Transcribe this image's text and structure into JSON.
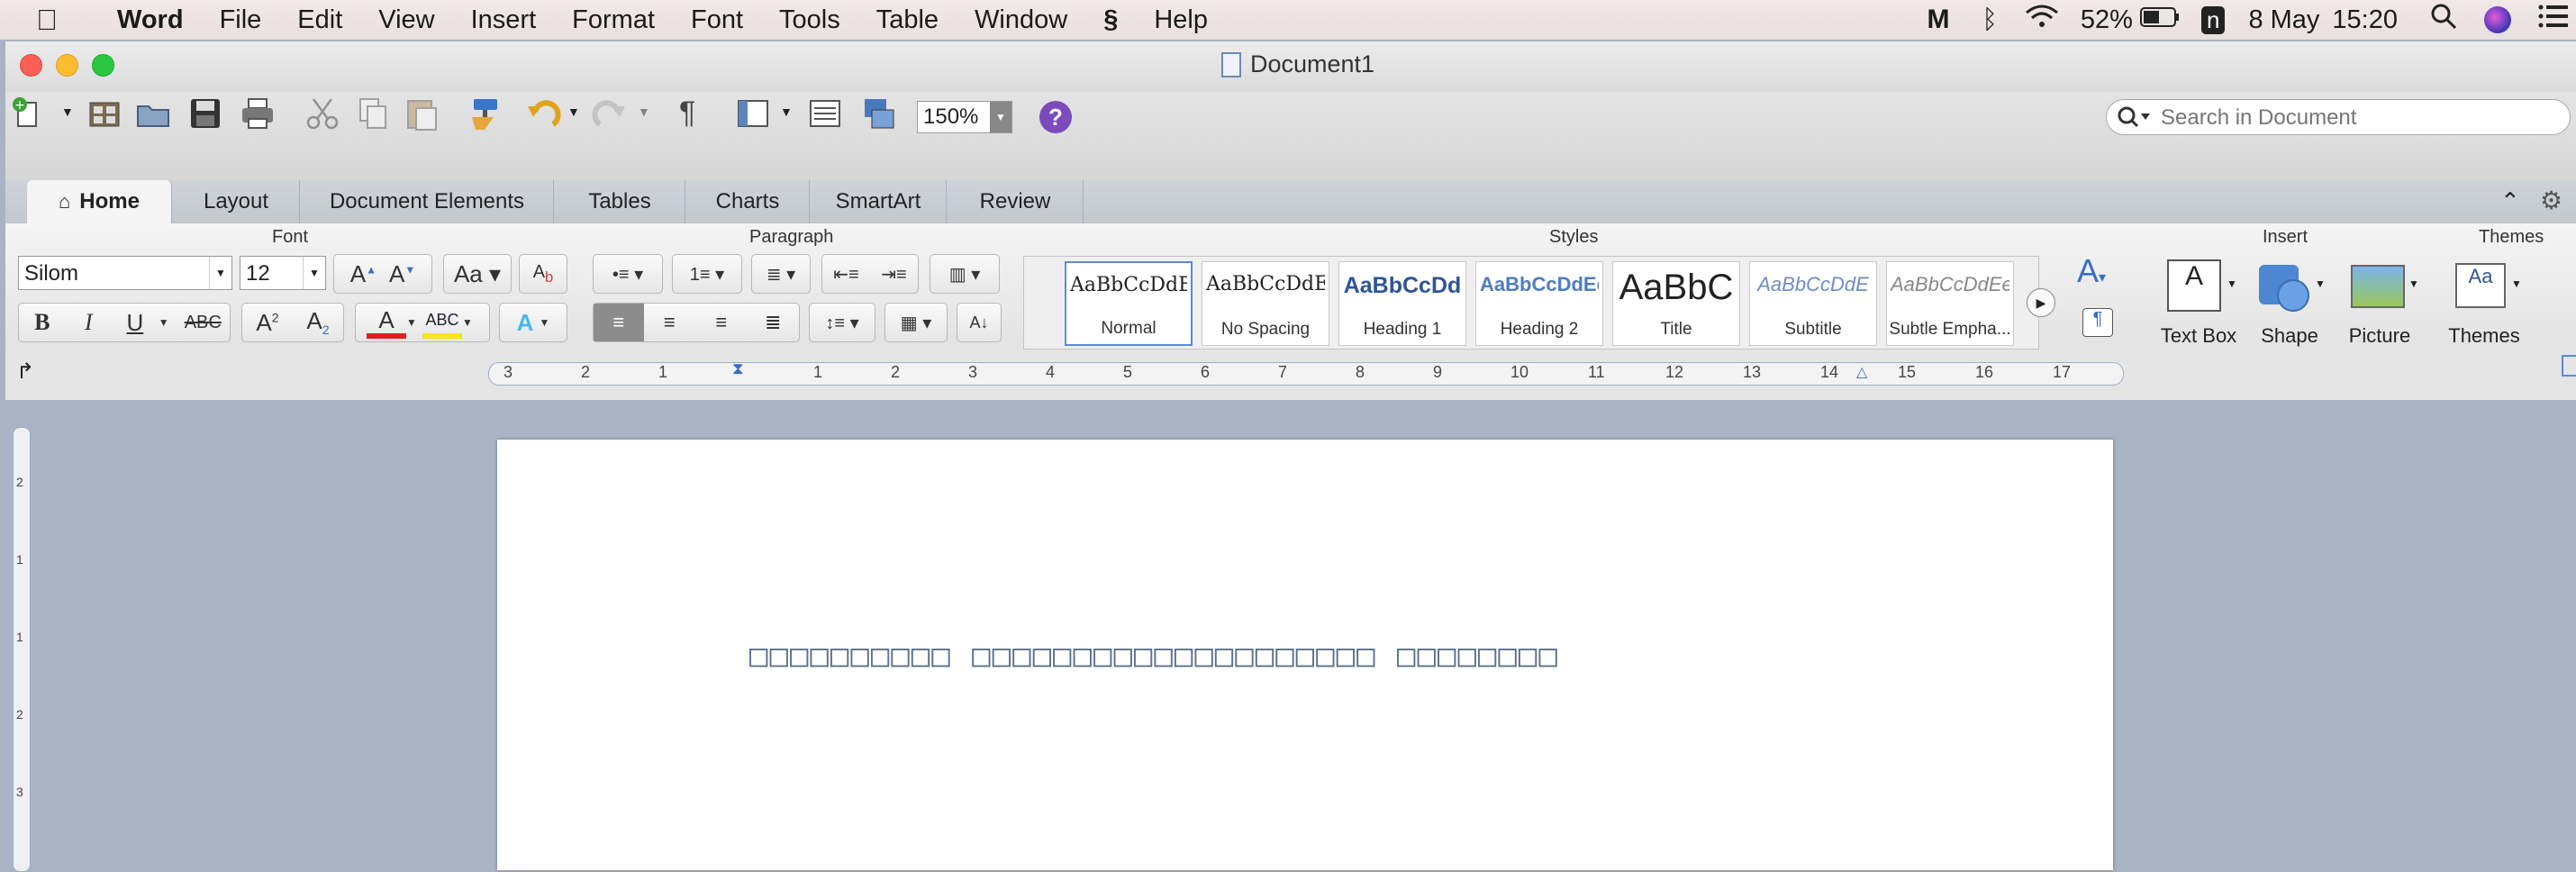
{
  "menubar": {
    "app_name": "Word",
    "items": [
      "File",
      "Edit",
      "View",
      "Insert",
      "Format",
      "Font",
      "Tools",
      "Table",
      "Window",
      "Help"
    ],
    "battery": "52%",
    "date": "8 May",
    "time": "15:20"
  },
  "window": {
    "title": "Document1"
  },
  "toolbar": {
    "zoom": "150%",
    "search_placeholder": "Search in Document"
  },
  "tabs": [
    "Home",
    "Layout",
    "Document Elements",
    "Tables",
    "Charts",
    "SmartArt",
    "Review"
  ],
  "ribbon": {
    "groups": {
      "font": "Font",
      "paragraph": "Paragraph",
      "styles": "Styles",
      "insert": "Insert",
      "themes": "Themes"
    },
    "font_name": "Silom",
    "font_size": "12",
    "styles": [
      {
        "preview": "AaBbCcDdEe",
        "name": "Normal"
      },
      {
        "preview": "AaBbCcDdEe",
        "name": "No Spacing"
      },
      {
        "preview": "AaBbCcDd",
        "name": "Heading 1"
      },
      {
        "preview": "AaBbCcDdEe",
        "name": "Heading 2"
      },
      {
        "preview": "AaBbC",
        "name": "Title"
      },
      {
        "preview": "AaBbCcDdE",
        "name": "Subtitle"
      },
      {
        "preview": "AaBbCcDdEe",
        "name": "Subtle Empha..."
      }
    ],
    "insert_buttons": {
      "text_box": "Text Box",
      "shape": "Shape",
      "picture": "Picture"
    },
    "themes_label": "Themes",
    "font_buttons": {
      "bold": "B",
      "italic": "I",
      "underline": "U",
      "strike": "ABC"
    }
  },
  "ruler": {
    "ticks": [
      "3",
      "2",
      "1",
      "1",
      "2",
      "3",
      "4",
      "5",
      "6",
      "7",
      "8",
      "9",
      "10",
      "11",
      "12",
      "13",
      "14",
      "15",
      "16",
      "17"
    ],
    "vticks": [
      "2",
      "1",
      "1",
      "2",
      "3"
    ]
  },
  "document": {
    "text": "□□□□□□□□□□ □□□□□□□□□□□□□□□□□□□□ □□□□□□□□"
  },
  "colors": {
    "accent_tab": "#f4f4f4",
    "page": "#ffffff",
    "background": "#a9b4c4",
    "font_color": "#e02020",
    "highlight": "#f4e51c"
  }
}
